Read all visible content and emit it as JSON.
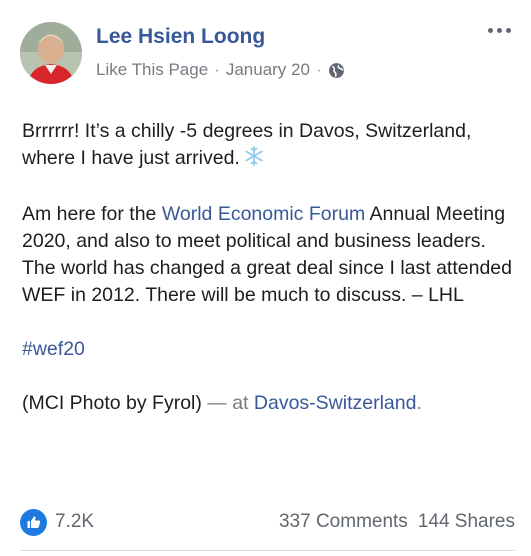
{
  "post": {
    "author": "Lee Hsien Loong",
    "like_page_label": "Like This Page",
    "separator": "·",
    "date": "January 20",
    "paragraphs": {
      "p1": "Brrrrrr! It’s a chilly -5 degrees in Davos, Switzerland, where I have just arrived.",
      "p2_before": "Am here for the ",
      "p2_link": "World Economic Forum",
      "p2_after": " Annual Meeting 2020, and also to meet political and business leaders. The world has changed a great deal since I last attended WEF in 2012. There will be much to discuss. – LHL",
      "hashtag": "#wef20",
      "photo_credit": "(MCI Photo by Fyrol)",
      "at_text": " — at ",
      "location": "Davos-Switzerland",
      "location_end": "."
    },
    "icons": {
      "globe": "globe-icon",
      "snowflake": "snowflake-icon",
      "more": "more-options-icon",
      "like": "like-thumb-icon"
    }
  },
  "reactions": {
    "like_count": "7.2K",
    "comments": "337 Comments",
    "shares": "144 Shares"
  },
  "colors": {
    "link": "#385898",
    "like_badge": "#1f7ae0",
    "muted": "#777b82"
  }
}
